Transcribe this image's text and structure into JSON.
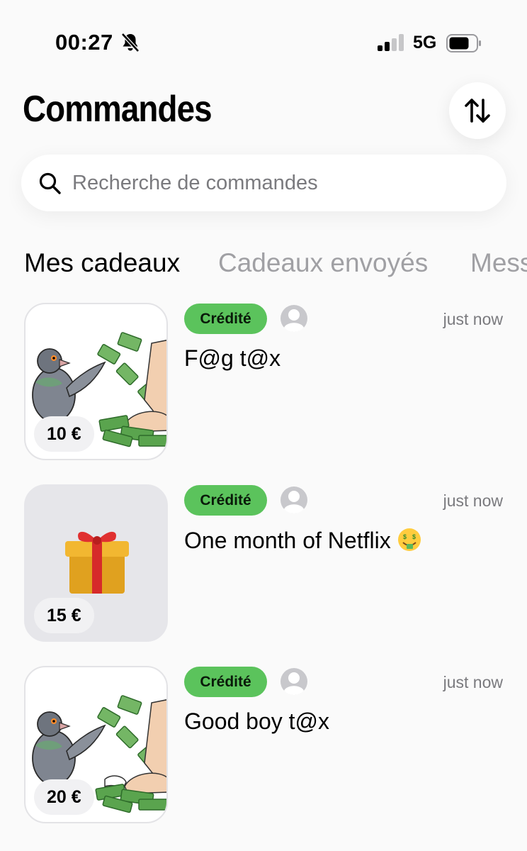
{
  "status_bar": {
    "time": "00:27",
    "network": "5G"
  },
  "header": {
    "title": "Commandes"
  },
  "search": {
    "placeholder": "Recherche de commandes",
    "value": ""
  },
  "tabs": [
    {
      "label": "Mes cadeaux",
      "active": true
    },
    {
      "label": "Cadeaux envoyés",
      "active": false
    },
    {
      "label": "Mess",
      "active": false
    }
  ],
  "orders": [
    {
      "status": "Crédité",
      "time": "just now",
      "title": "F@g t@x",
      "price": "10 €",
      "image": "pigeon-money-feet"
    },
    {
      "status": "Crédité",
      "time": "just now",
      "title": "One month of Netflix",
      "title_emoji": "money-mouth-face",
      "price": "15 €",
      "image": "gift-box"
    },
    {
      "status": "Crédité",
      "time": "just now",
      "title": "Good boy t@x",
      "price": "20 €",
      "image": "pigeon-money-feet-sock"
    }
  ],
  "colors": {
    "background": "#fafafa",
    "badge_green": "#5bc35c",
    "muted_text": "#7a7a7e",
    "inactive_tab": "#a0a0a4"
  }
}
